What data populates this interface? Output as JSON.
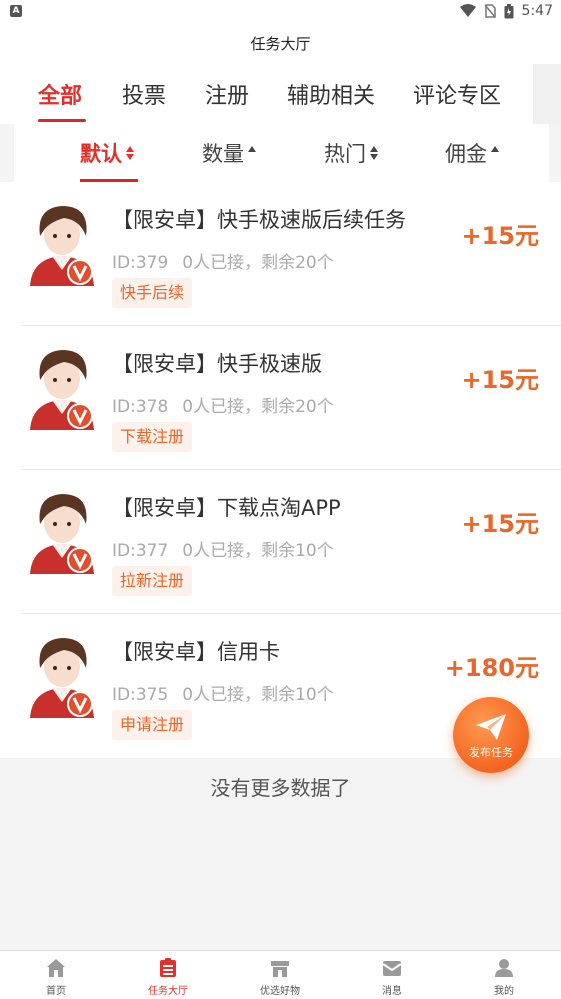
{
  "status": {
    "time": "5:47",
    "left_glyph": "A"
  },
  "header": {
    "title": "任务大厅"
  },
  "tabs": [
    {
      "label": "全部",
      "active": true
    },
    {
      "label": "投票",
      "active": false
    },
    {
      "label": "注册",
      "active": false
    },
    {
      "label": "辅助相关",
      "active": false
    },
    {
      "label": "评论专区",
      "active": false
    }
  ],
  "sort": [
    {
      "label": "默认",
      "indicator": "both",
      "active": true
    },
    {
      "label": "数量",
      "indicator": "up",
      "active": false
    },
    {
      "label": "热门",
      "indicator": "both",
      "active": false
    },
    {
      "label": "佣金",
      "indicator": "up",
      "active": false
    }
  ],
  "tasks": [
    {
      "title": "【限安卓】快手极速版后续任务",
      "id": "ID:379",
      "status": "0人已接，剩余20个",
      "tag": "快手后续",
      "reward": "+15元"
    },
    {
      "title": "【限安卓】快手极速版",
      "id": "ID:378",
      "status": "0人已接，剩余20个",
      "tag": "下载注册",
      "reward": "+15元"
    },
    {
      "title": "【限安卓】下载点淘APP",
      "id": "ID:377",
      "status": "0人已接，剩余10个",
      "tag": "拉新注册",
      "reward": "+15元"
    },
    {
      "title": "【限安卓】信用卡",
      "id": "ID:375",
      "status": "0人已接，剩余10个",
      "tag": "申请注册",
      "reward": "+180元"
    }
  ],
  "no_more_text": "没有更多数据了",
  "fab": {
    "label": "发布任务"
  },
  "bottom_nav": [
    {
      "label": "首页",
      "icon": "home-icon",
      "active": false
    },
    {
      "label": "任务大厅",
      "icon": "task-hall-icon",
      "active": true
    },
    {
      "label": "优选好物",
      "icon": "shop-icon",
      "active": false
    },
    {
      "label": "消息",
      "icon": "message-icon",
      "active": false
    },
    {
      "label": "我的",
      "icon": "profile-icon",
      "active": false
    }
  ],
  "colors": {
    "accent": "#e4302b",
    "reward": "#e8672a",
    "tag_bg": "#fdf1ec"
  }
}
